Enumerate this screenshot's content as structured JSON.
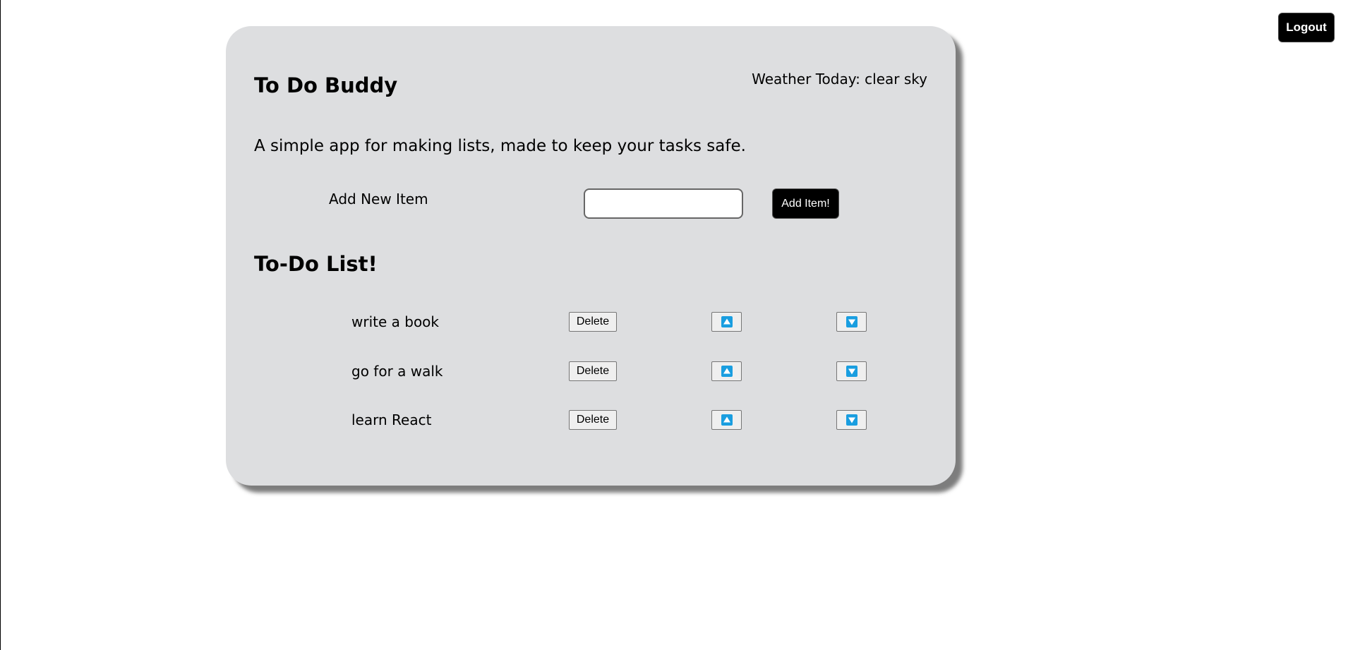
{
  "header": {
    "logout_label": "Logout"
  },
  "app": {
    "title": "To Do Buddy",
    "weather": "Weather Today: clear sky",
    "tagline": "A simple app for making lists, made to keep your tasks safe."
  },
  "add_item": {
    "label": "Add New Item",
    "input_value": "",
    "input_placeholder": "",
    "button_label": "Add Item!"
  },
  "list": {
    "title": "To-Do List!",
    "delete_label": "Delete",
    "up_icon": "arrow-up-icon",
    "down_icon": "arrow-down-icon",
    "items": [
      {
        "text": "write a book"
      },
      {
        "text": "go for a walk"
      },
      {
        "text": "learn React"
      }
    ]
  },
  "colors": {
    "card_background": "#dddee0",
    "button_dark": "#000000",
    "arrow_icon": "#1a9ee0"
  }
}
